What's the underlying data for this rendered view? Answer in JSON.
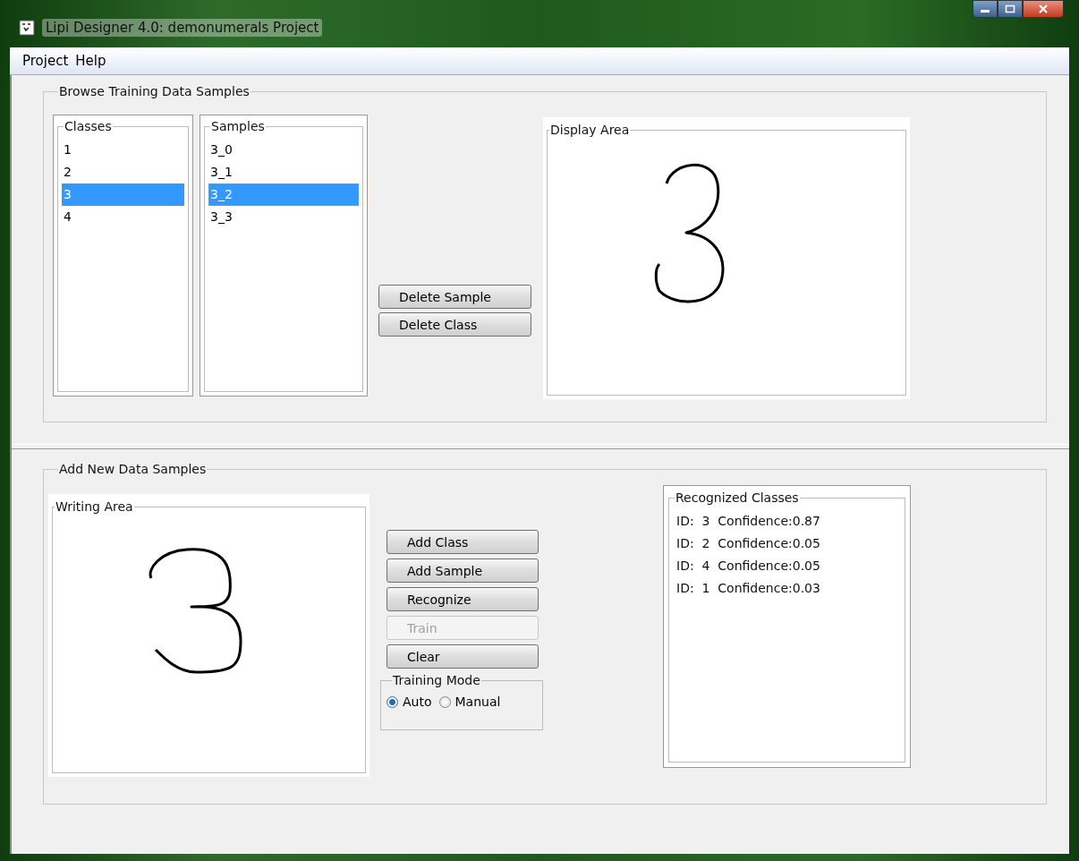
{
  "window": {
    "title": "Lipi Designer 4.0: demonumerals Project"
  },
  "menu": [
    "Project",
    "Help"
  ],
  "browse": {
    "title": "Browse Training Data Samples",
    "classes": {
      "title": "Classes",
      "items": [
        {
          "label": "1",
          "selected": false
        },
        {
          "label": "2",
          "selected": false
        },
        {
          "label": "3",
          "selected": true
        },
        {
          "label": "4",
          "selected": false
        }
      ]
    },
    "samples": {
      "title": "Samples",
      "items": [
        {
          "label": "3_0",
          "selected": false
        },
        {
          "label": "3_1",
          "selected": false
        },
        {
          "label": "3_2",
          "selected": true
        },
        {
          "label": "3_3",
          "selected": false
        }
      ]
    },
    "buttons": [
      {
        "label": "Delete Sample",
        "disabled": false
      },
      {
        "label": "Delete Class",
        "disabled": false
      }
    ],
    "display_area": {
      "title": "Display Area"
    }
  },
  "add": {
    "title": "Add New Data Samples",
    "writing_area": {
      "title": "Writing Area"
    },
    "buttons": [
      {
        "label": "Add Class",
        "disabled": false
      },
      {
        "label": "Add Sample",
        "disabled": false
      },
      {
        "label": "Recognize",
        "disabled": false
      },
      {
        "label": "Train",
        "disabled": true
      },
      {
        "label": "Clear",
        "disabled": false
      }
    ],
    "training_mode": {
      "title": "Training Mode",
      "options": [
        {
          "label": "Auto",
          "selected": true
        },
        {
          "label": "Manual",
          "selected": false
        }
      ]
    },
    "recognized": {
      "title": "Recognized Classes",
      "items": [
        "ID:  3  Confidence:0.87",
        "ID:  2  Confidence:0.05",
        "ID:  4  Confidence:0.05",
        "ID:  1  Confidence:0.03"
      ]
    }
  }
}
